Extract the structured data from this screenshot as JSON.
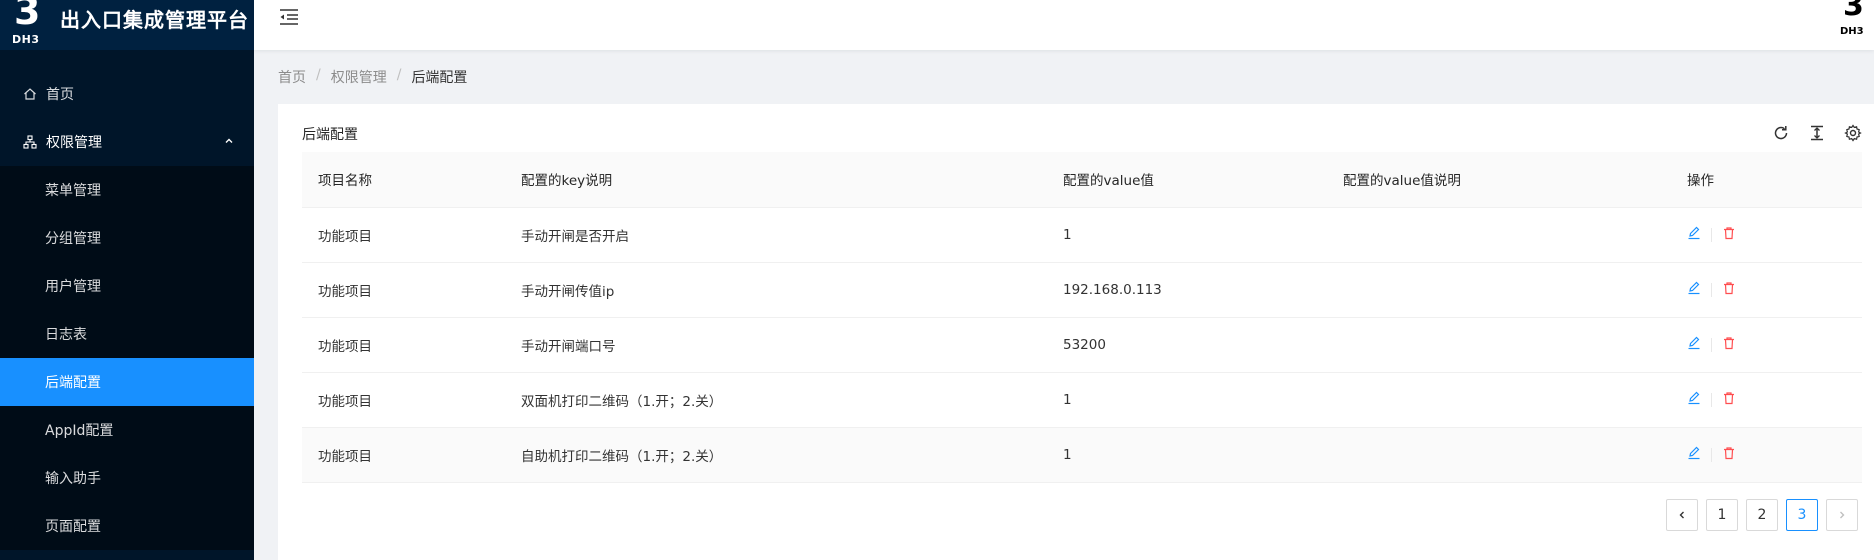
{
  "app": {
    "title": "出入口集成管理平台",
    "logo_digit": "3",
    "logo_text": "DH3"
  },
  "sidebar": {
    "items": [
      {
        "label": "首页",
        "icon": "home-icon"
      },
      {
        "label": "权限管理",
        "icon": "cluster-icon",
        "expanded": true,
        "children": [
          {
            "label": "菜单管理"
          },
          {
            "label": "分组管理"
          },
          {
            "label": "用户管理"
          },
          {
            "label": "日志表"
          },
          {
            "label": "后端配置",
            "active": true
          },
          {
            "label": "AppId配置"
          },
          {
            "label": "输入助手"
          },
          {
            "label": "页面配置"
          }
        ]
      }
    ]
  },
  "breadcrumb": {
    "home": "首页",
    "section": "权限管理",
    "current": "后端配置"
  },
  "card": {
    "title": "后端配置",
    "tools": [
      "reload-icon",
      "column-height-icon",
      "setting-icon"
    ]
  },
  "table": {
    "columns": [
      "项目名称",
      "配置的key说明",
      "配置的value值",
      "配置的value值说明",
      "操作"
    ],
    "rows": [
      {
        "name": "功能项目",
        "key_desc": "手动开闸是否开启",
        "value": "1",
        "value_desc": ""
      },
      {
        "name": "功能项目",
        "key_desc": "手动开闸传值ip",
        "value": "192.168.0.113",
        "value_desc": ""
      },
      {
        "name": "功能项目",
        "key_desc": "手动开闸端口号",
        "value": "53200",
        "value_desc": ""
      },
      {
        "name": "功能项目",
        "key_desc": "双面机打印二维码（1.开；2.关）",
        "value": "1",
        "value_desc": ""
      },
      {
        "name": "功能项目",
        "key_desc": "自助机打印二维码（1.开；2.关）",
        "value": "1",
        "value_desc": ""
      }
    ]
  },
  "pagination": {
    "pages": [
      "1",
      "2",
      "3"
    ],
    "current": "3"
  },
  "colors": {
    "sidebar_bg": "#001529",
    "submenu_bg": "#000c17",
    "accent": "#1890ff",
    "danger": "#ff4d4f"
  }
}
